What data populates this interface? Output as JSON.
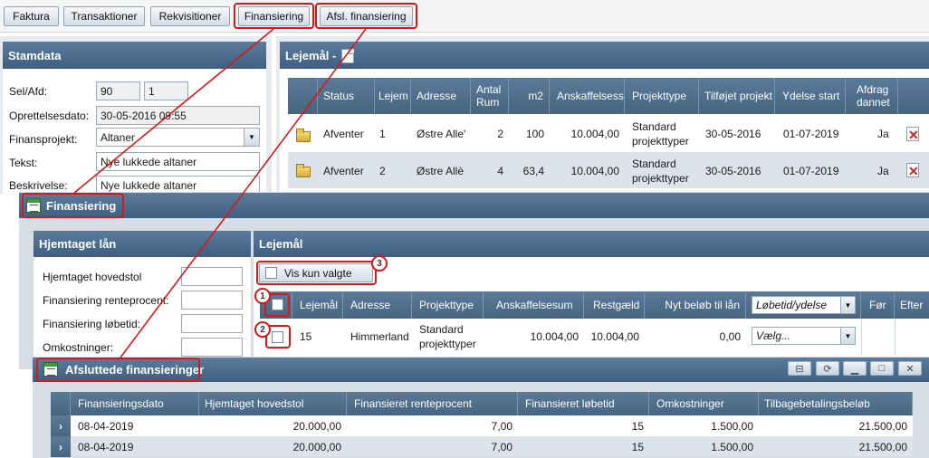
{
  "toolbar": {
    "buttons": [
      "Faktura",
      "Transaktioner",
      "Rekvisitioner",
      "Finansiering",
      "Afsl. finansiering"
    ]
  },
  "stamdata": {
    "title": "Stamdata",
    "sel_label": "Sel/Afd:",
    "sel_value": "90",
    "afd_value": "1",
    "created_label": "Oprettelsesdato:",
    "created_value": "30-05-2016 09:55",
    "project_label": "Finansprojekt:",
    "project_value": "Altaner",
    "text_label": "Tekst:",
    "text_value": "Nye lukkede altaner",
    "desc_label": "Beskrivelse:",
    "desc_value": "Nye lukkede altaner"
  },
  "lejemaal_top": {
    "title": "Lejemål -",
    "columns": [
      "Status",
      "Lejem",
      "Adresse",
      "Antal Rum",
      "m2",
      "Anskaffelsess",
      "Projekttype",
      "Tilføjet projekt",
      "Ydelse start",
      "Afdrag dannet"
    ],
    "rows": [
      {
        "status": "Afventer",
        "lejem": "1",
        "adresse": "Østre Alle'",
        "rum": "2",
        "m2": "100",
        "ansk": "10.004,00",
        "type": "Standard projekttyper",
        "tilfojet": "30-05-2016",
        "start": "01-07-2019",
        "afdrag": "Ja"
      },
      {
        "status": "Afventer",
        "lejem": "2",
        "adresse": "Østre Allè",
        "rum": "4",
        "m2": "63,4",
        "ansk": "10.004,00",
        "type": "Standard projekttyper",
        "tilfojet": "30-05-2016",
        "start": "01-07-2019",
        "afdrag": "Ja"
      }
    ]
  },
  "finansiering": {
    "title": "Finansiering",
    "loan_title": "Hjemtaget lån",
    "loan_fields": [
      "Hjemtaget hovedstol",
      "Finansiering renteprocent:",
      "Finansiering løbetid:",
      "Omkostninger:"
    ],
    "lejemaal_title": "Lejemål",
    "filter_label": "Vis kun valgte",
    "columns": [
      "Lejemål",
      "Adresse",
      "Projekttype",
      "Anskaffelsesum",
      "Restgæld",
      "Nyt beløb til lån",
      "Før",
      "Efter"
    ],
    "dropdown_header": "Løbetid/ydelse",
    "row": {
      "lejemaal": "15",
      "adresse": "Himmerland",
      "type": "Standard projekttyper",
      "ansk": "10.004,00",
      "rest": "10.004,00",
      "nyt": "0,00",
      "select": "Vælg..."
    },
    "markers": [
      "1",
      "2",
      "3"
    ]
  },
  "afsluttede": {
    "title": "Afsluttede finansieringer",
    "columns": [
      "Finansieringsdato",
      "Hjemtaget hovedstol",
      "Finansieret renteprocent",
      "Finansieret løbetid",
      "Omkostninger",
      "Tilbagebetalingsbeløb"
    ],
    "rows": [
      {
        "dato": "08-04-2019",
        "hovedstol": "20.000,00",
        "rente": "7,00",
        "lobetid": "15",
        "omk": "1.500,00",
        "tilbage": "21.500,00"
      },
      {
        "dato": "08-04-2019",
        "hovedstol": "20.000,00",
        "rente": "7,00",
        "lobetid": "15",
        "omk": "1.500,00",
        "tilbage": "21.500,00"
      }
    ]
  },
  "colors": {
    "header": "#46657f",
    "highlight": "#d81818",
    "row_alt": "#dde3ea"
  }
}
